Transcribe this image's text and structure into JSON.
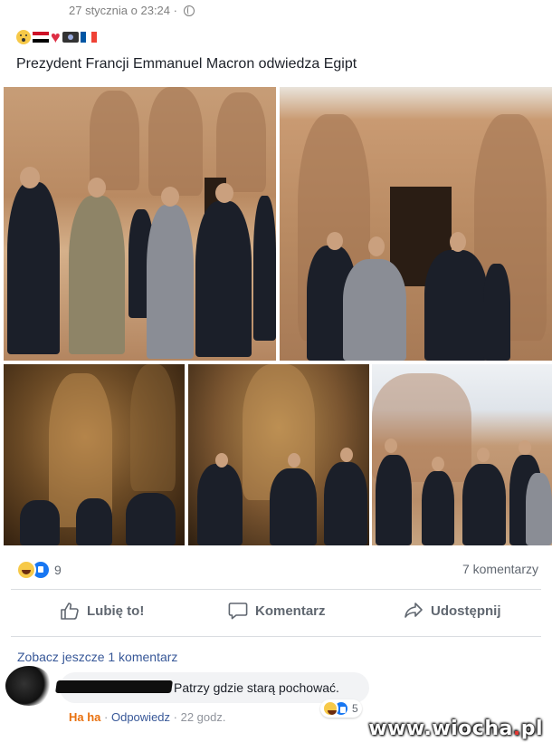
{
  "post": {
    "timestamp": "27 stycznia o 23:24 ·",
    "text": "Prezydent Francji Emmanuel Macron odwiedza Egipt",
    "emoji_icons": [
      "astonished-face-emoji",
      "egypt-flag-emoji",
      "red-heart-emoji",
      "camera-emoji",
      "france-flag-emoji"
    ]
  },
  "reactions": {
    "count": "9",
    "comments_count": "7 komentarzy"
  },
  "actions": {
    "like": "Lubię to!",
    "comment": "Komentarz",
    "share": "Udostępnij"
  },
  "comments": {
    "see_more": "Zobacz jeszcze 1 komentarz",
    "items": [
      {
        "text": "Patrzy gdzie starą pochować.",
        "reaction_count": "5",
        "reaction_label": "Ha ha",
        "reply_label": "Odpowiedz",
        "time": "22 godz."
      }
    ]
  },
  "watermark": {
    "prefix": "www.wiocha",
    "dot": ".",
    "suffix": "pl"
  },
  "colors": {
    "link": "#385898",
    "like_blue": "#1877f2",
    "haha_orange": "#e9710f",
    "muted": "#606770"
  }
}
